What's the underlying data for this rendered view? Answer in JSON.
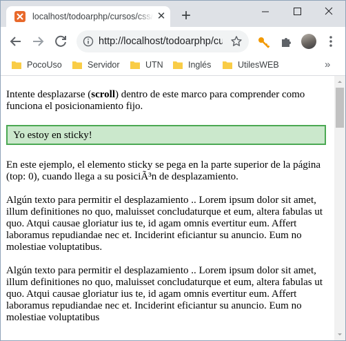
{
  "browser": {
    "tab": {
      "title": "localhost/todoarphp/cursos/css/ejemplos/position-sticky.html",
      "close_glyph": "✕"
    },
    "new_tab_glyph": "+",
    "window_controls": {
      "minimize": "minimize-icon",
      "maximize": "maximize-icon",
      "close": "close-icon"
    },
    "address_bar": {
      "url": "http://localhost/todoarphp/cursos/css/ejemplos/"
    },
    "bookmarks": [
      {
        "label": "PocoUso"
      },
      {
        "label": "Servidor"
      },
      {
        "label": "UTN"
      },
      {
        "label": "Inglés"
      },
      {
        "label": "UtilesWEB"
      }
    ],
    "bookmarks_overflow": "»",
    "colors": {
      "tabstrip": "#dee1e6",
      "favicon": "#e8692b",
      "folder": "#f9cc46",
      "key_ext": "#f29900"
    }
  },
  "page": {
    "intro_before": "Intente desplazarse (",
    "intro_bold": "scroll",
    "intro_after": ") dentro de este marco para comprender como funciona el posicionamiento fijo.",
    "sticky_text": "Yo estoy en sticky!",
    "explanation": "En este ejemplo, el elemento sticky se pega en la parte superior de la página (top: 0), cuando llega a su posiciÃ³n de desplazamiento.",
    "paragraph_1": "Algún texto para permitir el desplazamiento .. Lorem ipsum dolor sit amet, illum definitiones no quo, maluisset concludaturque et eum, altera fabulas ut quo. Atqui causae gloriatur ius te, id agam omnis evertitur eum. Affert laboramus repudiandae nec et. Inciderint eficiantur su anuncio. Eum no molestiae voluptatibus.",
    "paragraph_2": "Algún texto para permitir el desplazamiento .. Lorem ipsum dolor sit amet, illum definitiones no quo, maluisset concludaturque et eum, altera fabulas ut quo. Atqui causae gloriatur ius te, id agam omnis evertitur eum. Affert laboramus repudiandae nec et. Inciderint eficiantur su anuncio. Eum no molestiae voluptatibus",
    "colors": {
      "sticky_bg": "#cbe8cc",
      "sticky_border": "#4aa852"
    }
  }
}
